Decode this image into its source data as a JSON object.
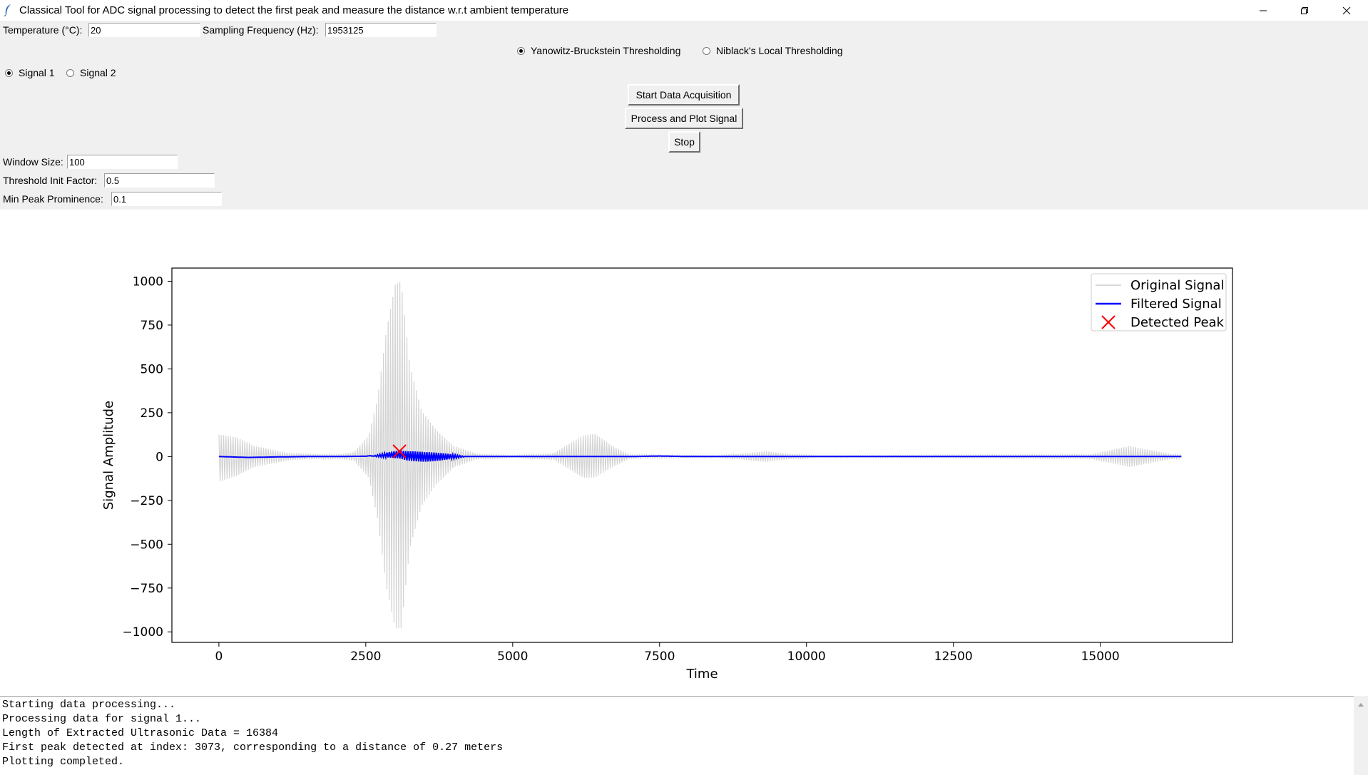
{
  "window": {
    "title": "Classical Tool for ADC signal processing to detect the first peak and measure the distance w.r.t ambient temperature"
  },
  "controls": {
    "temperature_label": "Temperature (°C):",
    "temperature_value": "20",
    "sampling_label": "Sampling Frequency (Hz):",
    "sampling_value": "1953125",
    "method_options": [
      "Yanowitz-Bruckstein Thresholding",
      "Niblack's Local Thresholding"
    ],
    "method_selected": "Yanowitz-Bruckstein Thresholding",
    "signal_options": [
      "Signal 1",
      "Signal 2"
    ],
    "signal_selected": "Signal 1",
    "start_button": "Start Data Acquisition",
    "process_button": "Process and Plot Signal",
    "stop_button": "Stop",
    "window_size_label": "Window Size:",
    "window_size_value": "100",
    "threshold_label": "Threshold Init Factor:",
    "threshold_value": "0.5",
    "prominence_label": "Min Peak Prominence:",
    "prominence_value": "0.1"
  },
  "chart_data": {
    "type": "line",
    "title": "",
    "xlabel": "Time",
    "ylabel": "Signal Amplitude",
    "xlim": [
      -800,
      17250
    ],
    "ylim": [
      -1060,
      1075
    ],
    "xticks": [
      0,
      2500,
      5000,
      7500,
      10000,
      12500,
      15000
    ],
    "xtick_labels": [
      "0",
      "2500",
      "5000",
      "7500",
      "10000",
      "12500",
      "15000"
    ],
    "yticks": [
      1000,
      750,
      500,
      250,
      0,
      -250,
      -500,
      -750,
      -1000
    ],
    "ytick_labels": [
      "1000",
      "750",
      "500",
      "250",
      "0",
      "−250",
      "−500",
      "−750",
      "−1000"
    ],
    "grid": false,
    "legend_position": "top-right",
    "series": [
      {
        "name": "Original Signal",
        "color": "#d3d3d3",
        "style": "oscillating envelope",
        "length": 16384,
        "envelope_upper": [
          [
            0,
            125
          ],
          [
            300,
            110
          ],
          [
            600,
            60
          ],
          [
            1200,
            20
          ],
          [
            2000,
            10
          ],
          [
            2300,
            25
          ],
          [
            2550,
            120
          ],
          [
            2700,
            330
          ],
          [
            2850,
            720
          ],
          [
            3000,
            980
          ],
          [
            3100,
            1000
          ],
          [
            3250,
            520
          ],
          [
            3450,
            260
          ],
          [
            3700,
            150
          ],
          [
            4000,
            60
          ],
          [
            4400,
            15
          ],
          [
            5000,
            5
          ],
          [
            5700,
            20
          ],
          [
            6000,
            80
          ],
          [
            6200,
            120
          ],
          [
            6400,
            130
          ],
          [
            6700,
            60
          ],
          [
            7000,
            10
          ],
          [
            8500,
            5
          ],
          [
            9000,
            20
          ],
          [
            9300,
            30
          ],
          [
            9700,
            15
          ],
          [
            10200,
            5
          ],
          [
            14400,
            10
          ],
          [
            14800,
            10
          ],
          [
            15000,
            25
          ],
          [
            15300,
            45
          ],
          [
            15500,
            60
          ],
          [
            15800,
            40
          ],
          [
            16200,
            15
          ],
          [
            16384,
            10
          ]
        ],
        "envelope_lower": [
          [
            0,
            -145
          ],
          [
            300,
            -110
          ],
          [
            600,
            -60
          ],
          [
            1200,
            -20
          ],
          [
            2000,
            -10
          ],
          [
            2300,
            -25
          ],
          [
            2550,
            -120
          ],
          [
            2700,
            -350
          ],
          [
            2850,
            -740
          ],
          [
            3000,
            -980
          ],
          [
            3100,
            -980
          ],
          [
            3250,
            -520
          ],
          [
            3450,
            -280
          ],
          [
            3700,
            -160
          ],
          [
            4000,
            -60
          ],
          [
            4400,
            -15
          ],
          [
            5000,
            -5
          ],
          [
            5700,
            -20
          ],
          [
            6000,
            -80
          ],
          [
            6200,
            -120
          ],
          [
            6400,
            -120
          ],
          [
            6700,
            -60
          ],
          [
            7000,
            -10
          ],
          [
            8500,
            -5
          ],
          [
            9000,
            -20
          ],
          [
            9300,
            -30
          ],
          [
            9700,
            -15
          ],
          [
            10200,
            -5
          ],
          [
            14400,
            -10
          ],
          [
            14800,
            -10
          ],
          [
            15000,
            -25
          ],
          [
            15300,
            -45
          ],
          [
            15500,
            -60
          ],
          [
            15800,
            -40
          ],
          [
            16200,
            -15
          ],
          [
            16384,
            -10
          ]
        ]
      },
      {
        "name": "Filtered Signal",
        "color": "#0000ff",
        "points": [
          [
            0,
            0
          ],
          [
            500,
            -5
          ],
          [
            1000,
            -2
          ],
          [
            1500,
            0
          ],
          [
            2000,
            0
          ],
          [
            2500,
            2
          ],
          [
            2700,
            10
          ],
          [
            2900,
            25
          ],
          [
            3073,
            30
          ],
          [
            3200,
            10
          ],
          [
            3500,
            -5
          ],
          [
            4000,
            0
          ],
          [
            5000,
            0
          ],
          [
            6000,
            0
          ],
          [
            7000,
            0
          ],
          [
            7500,
            3
          ],
          [
            8000,
            0
          ],
          [
            10000,
            0
          ],
          [
            12500,
            0
          ],
          [
            15000,
            0
          ],
          [
            16384,
            0
          ]
        ],
        "ripple_range": [
          2600,
          4200
        ]
      },
      {
        "name": "Detected Peak",
        "color": "#ff0000",
        "marker": "x",
        "points": [
          [
            3073,
            30
          ]
        ]
      }
    ]
  },
  "log": {
    "lines": [
      "Starting data processing...",
      "Processing data for signal 1...",
      "Length of Extracted Ultrasonic Data = 16384",
      "First peak detected at index: 3073, corresponding to a distance of 0.27 meters",
      "Plotting completed."
    ]
  }
}
